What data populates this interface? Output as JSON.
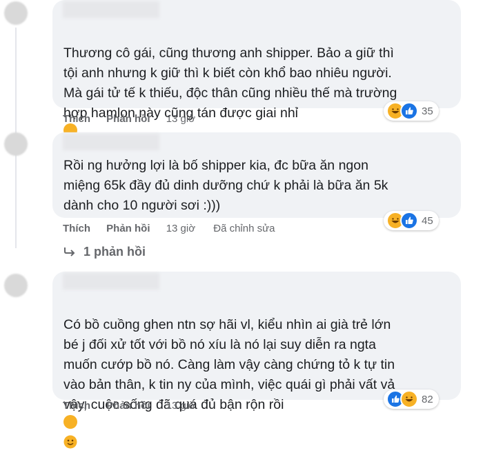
{
  "comments": [
    {
      "text": "Thương cô gái, cũng thương anh shipper. Bảo a giữ thì\ntội anh nhưng k giữ thì k biết còn khổ bao nhiêu người.\nMà gái tử tế k thiếu, độc thân cũng nhiều thế mà trường\nhợp hamlon này cũng tán được giai nhỉ",
      "inline_emoji": "tears-of-joy-emoji",
      "like_label": "Thích",
      "reply_label": "Phản hồi",
      "time": "13 giờ",
      "reactions": [
        "haha",
        "like"
      ],
      "reaction_count": "35"
    },
    {
      "text": "Rồi ng hưởng lợi là bố shipper kia, đc bữa ăn ngon\nmiệng 65k đầy đủ dinh dưỡng chứ k phải là bữa ăn 5k\ndành cho 10 người sơi :)))",
      "like_label": "Thích",
      "reply_label": "Phản hồi",
      "time": "13 giờ",
      "edited": "Đã chỉnh sửa",
      "reactions": [
        "haha",
        "like"
      ],
      "reaction_count": "45",
      "replies_label": "1 phản hồi"
    },
    {
      "text": "Có bồ cuồng ghen ntn sợ hãi vl, kiểu nhìn ai già trẻ lớn\nbé j đối xử tốt với bồ nó xíu là nó lại suy diễn ra ngta\nmuốn cướp bồ nó. Càng làm vậy càng chứng tỏ k tự tin\nvào bản thân, k tin ny của mình, việc quái gì phải vất vả\nvậy, cuộc sống đã quá đủ bận rộn rồi",
      "inline_emoji": "slightly-smiling-emoji",
      "like_label": "Thích",
      "reply_label": "Phản hồi",
      "time": "13 giờ",
      "reactions": [
        "like",
        "haha"
      ],
      "reaction_count": "82"
    }
  ],
  "colors": {
    "bubble": "#f0f2f5",
    "text": "#1c1e21",
    "secondary": "#65676b",
    "like_blue": "#1b74e4",
    "haha_yellow": "#f7b125"
  }
}
